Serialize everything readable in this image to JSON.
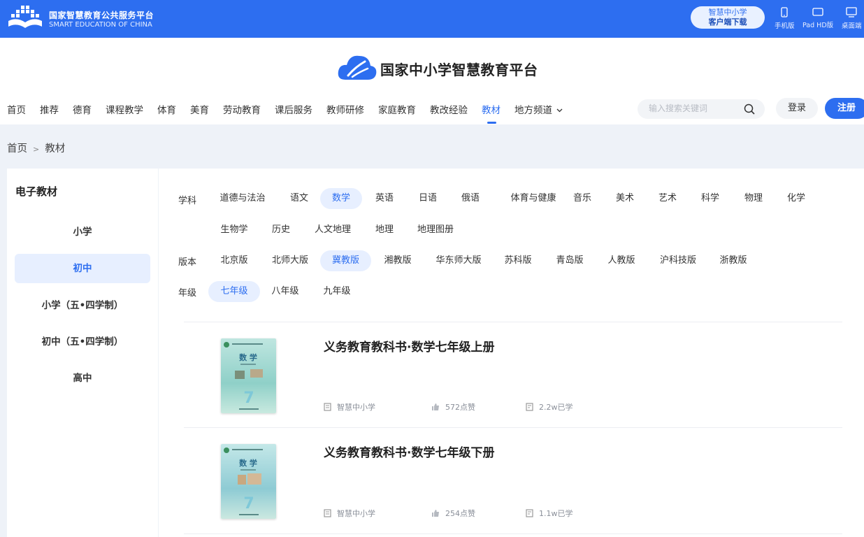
{
  "topbar": {
    "title_cn": "国家智慧教育公共服务平台",
    "title_en": "SMART EDUCATION OF CHINA",
    "client_line1": "智慧中小学",
    "client_line2": "客户端下载",
    "devices": [
      "手机版",
      "Pad HD版",
      "桌面端"
    ]
  },
  "header": {
    "brand": "国家中小学智慧教育平台",
    "nav": [
      "首页",
      "推荐",
      "德育",
      "课程教学",
      "体育",
      "美育",
      "劳动教育",
      "课后服务",
      "教师研修",
      "家庭教育",
      "教改经验",
      "教材",
      "地方频道"
    ],
    "active_nav": "教材",
    "search_placeholder": "输入搜索关键词",
    "login": "登录",
    "register": "注册"
  },
  "breadcrumb": {
    "home": "首页",
    "sep": ">",
    "current": "教材"
  },
  "sidebar": {
    "title": "电子教材",
    "items": [
      "小学",
      "初中",
      "小学（五•四学制）",
      "初中（五•四学制）",
      "高中"
    ],
    "active": "初中"
  },
  "filters": {
    "subject_label": "学科",
    "subjects_row1": [
      "道德与法治",
      "语文",
      "数学",
      "英语",
      "日语",
      "俄语",
      "体育与健康",
      "音乐",
      "美术",
      "艺术",
      "科学",
      "物理",
      "化学"
    ],
    "subjects_row2": [
      "生物学",
      "历史",
      "人文地理",
      "地理",
      "地理图册"
    ],
    "subject_active": "数学",
    "version_label": "版本",
    "versions": [
      "北京版",
      "北师大版",
      "冀教版",
      "湘教版",
      "华东师大版",
      "苏科版",
      "青岛版",
      "人教版",
      "沪科技版",
      "浙教版"
    ],
    "version_active": "冀教版",
    "grade_label": "年级",
    "grades": [
      "七年级",
      "八年级",
      "九年级"
    ],
    "grade_active": "七年级"
  },
  "books": [
    {
      "title": "义务教育教科书·数学七年级上册",
      "source": "智慧中小学",
      "likes": "572点赞",
      "learners": "2.2w已学",
      "cover_title": "数 学",
      "cover_grade": "7"
    },
    {
      "title": "义务教育教科书·数学七年级下册",
      "source": "智慧中小学",
      "likes": "254点赞",
      "learners": "1.1w已学",
      "cover_title": "数 学",
      "cover_grade": "7"
    }
  ],
  "colors": {
    "primary": "#2d6ef0",
    "active_bg": "#e7efff",
    "page_bg": "#eef2f8"
  }
}
